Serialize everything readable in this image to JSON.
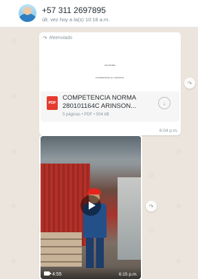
{
  "header": {
    "contact_name": "+57 311 2697895",
    "last_seen": "últ. vez hoy a la(s) 10:18 a.m."
  },
  "messages": {
    "document": {
      "forwarded_label": "Reenviado",
      "preview_title": "INFORME",
      "preview_subtitle": "COMPETENCIA LABORAL",
      "file_type_badge": "PDF",
      "file_name": "COMPETENCIA NORMA 280101164C ARINSON...",
      "meta": "5 páginas • PDF • 504 kB",
      "time": "6:04 p.m."
    },
    "video": {
      "duration": "4:55",
      "time": "6:15 p.m."
    }
  },
  "icons": {
    "forward": "forward-icon",
    "download": "download-icon",
    "play": "play-icon",
    "video_camera": "video-camera-icon",
    "pdf": "pdf-icon"
  },
  "colors": {
    "chat_background": "#ece5dd",
    "pdf_red": "#e53a2f",
    "header_background": "#ffffff"
  }
}
